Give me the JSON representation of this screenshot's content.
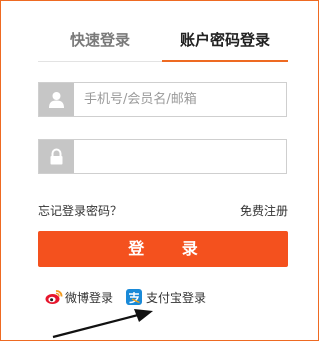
{
  "tabs": {
    "quick_login": "快速登录",
    "account_login": "账户密码登录"
  },
  "form": {
    "username_placeholder": "手机号/会员名/邮箱",
    "password_placeholder": ""
  },
  "links": {
    "forgot_password": "忘记登录密码？",
    "register": "免费注册"
  },
  "login_button": "登 录",
  "third_party": {
    "weibo": "微博登录",
    "alipay": "支付宝登录"
  },
  "colors": {
    "accent": "#f4511e",
    "border": "#ee6a22"
  },
  "icons": {
    "user": "user-icon",
    "lock": "lock-icon",
    "weibo": "weibo-icon",
    "alipay": "alipay-icon",
    "arrow": "arrow-annotation"
  }
}
